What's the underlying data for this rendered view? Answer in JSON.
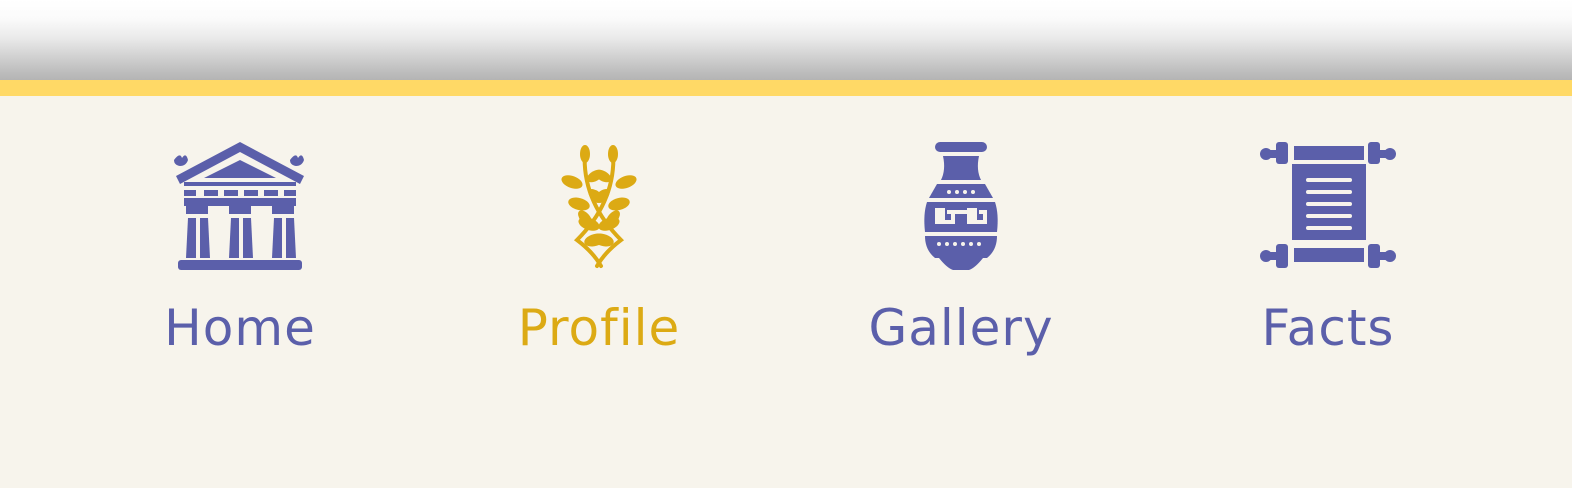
{
  "nav": {
    "colors": {
      "default": "#5b5faa",
      "active": "#dcaa14",
      "accent_bar": "#ffd966",
      "background": "#f7f4ec"
    },
    "items": [
      {
        "label": "Home",
        "icon": "temple-icon",
        "active": false
      },
      {
        "label": "Profile",
        "icon": "laurel-wreath-icon",
        "active": true
      },
      {
        "label": "Gallery",
        "icon": "amphora-vase-icon",
        "active": false
      },
      {
        "label": "Facts",
        "icon": "scroll-icon",
        "active": false
      }
    ]
  }
}
